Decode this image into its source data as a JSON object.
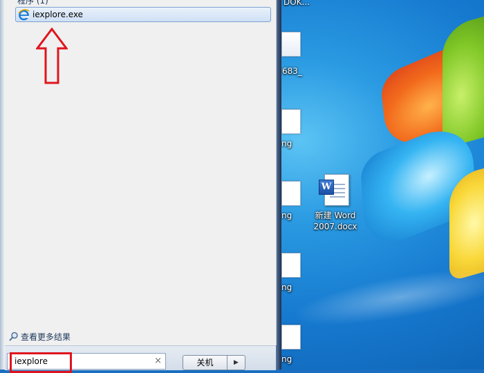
{
  "start_menu": {
    "group_header": "程序 (1)",
    "results": [
      {
        "label": "iexplore.exe",
        "icon": "internet-explorer-icon"
      }
    ],
    "see_more": "查看更多结果",
    "search": {
      "value": "iexplore",
      "clear_glyph": "×"
    },
    "shutdown_label": "关机",
    "shutdown_arrow": "▶"
  },
  "annotations": {
    "color": "#e0141e"
  },
  "desktop": {
    "partial_labels": [
      "683_",
      "ng",
      "ng",
      "ng",
      "ng"
    ],
    "top_clipped_label": "DOK...",
    "word_file": {
      "badge": "W",
      "label": "新建 Word 2007.docx"
    }
  }
}
